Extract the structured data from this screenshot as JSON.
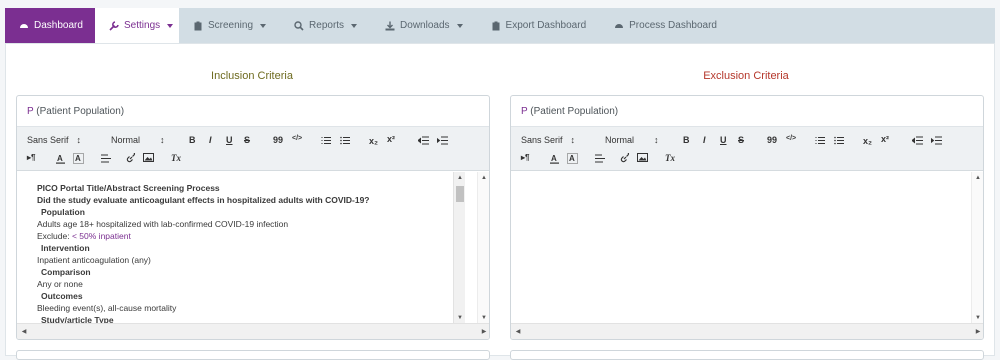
{
  "nav": {
    "dashboard": "Dashboard",
    "settings": "Settings",
    "screening": "Screening",
    "reports": "Reports",
    "downloads": "Downloads",
    "export": "Export Dashboard",
    "process": "Process Dashboard"
  },
  "inclusion": {
    "title": "Inclusion Criteria",
    "card_letter": "P",
    "card_label": "(Patient Population)"
  },
  "exclusion": {
    "title": "Exclusion Criteria",
    "card_letter": "P",
    "card_label": "(Patient Population)"
  },
  "toolbar": {
    "font": "Sans Serif",
    "size": "Normal",
    "bold": "B",
    "italic": "I",
    "underline": "U",
    "strike": "S",
    "quote": "99",
    "code": "</>",
    "sub": "x₂",
    "sup": "x²",
    "rtl": "¶",
    "clean": "Tx"
  },
  "editor_lines": [
    "PICO Portal Title/Abstract Screening Process",
    "Did the study evaluate anticoagulant effects in hospitalized adults with COVID-19?",
    "Population",
    "Adults age 18+ hospitalized with lab-confirmed COVID-19 infection",
    "Exclude:",
    "< 50% inpatient",
    "Intervention",
    "Inpatient anticoagulation (any)",
    "Comparison",
    "Any or none",
    "Outcomes",
    "Bleeding event(s), all-cause mortality",
    "Study/article Type"
  ],
  "colors": {
    "accent": "#7b2f91",
    "inclusion_title": "#6e6b1f",
    "exclusion_title": "#b5372b",
    "nav_bg": "#d2dde4"
  }
}
